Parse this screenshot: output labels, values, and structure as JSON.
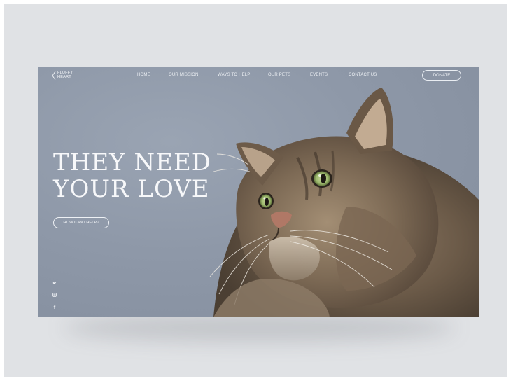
{
  "logo": {
    "line1": "FLUFFY",
    "line2": "HEART"
  },
  "nav": {
    "items": [
      {
        "label": "HOME"
      },
      {
        "label": "OUR MISSION"
      },
      {
        "label": "WAYS TO HELP"
      },
      {
        "label": "OUR PETS"
      },
      {
        "label": "EVENTS"
      },
      {
        "label": "CONTACT US"
      }
    ],
    "donate_label": "DONATE"
  },
  "hero": {
    "headline_line1": "THEY NEED",
    "headline_line2": "YOUR LOVE",
    "cta_label": "HOW CAN I HELP?"
  },
  "social": [
    "twitter-icon",
    "instagram-icon",
    "facebook-icon"
  ],
  "colors": {
    "background": "#e1e3e6",
    "hero_bg": "#8e98a8",
    "text": "#f7f8fa",
    "fur_dark": "#4a3d30",
    "fur_light": "#b9a58c",
    "eye": "#a6c27a"
  }
}
